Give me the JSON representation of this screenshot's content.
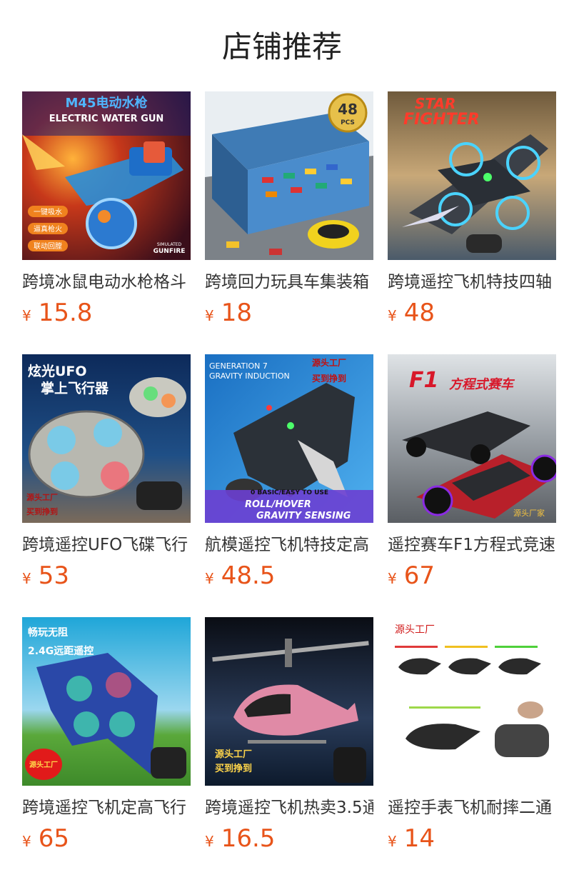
{
  "header": {
    "title": "店铺推荐"
  },
  "currency": "¥",
  "products": [
    {
      "name": "跨境冰鼠电动水枪格斗",
      "price": "15.8",
      "icon": "water-gun-image",
      "img_text": [
        "M45电动水枪",
        "ELECTRIC WATER GUN",
        "一键吸水",
        "逼真枪火",
        "联动回膛",
        "SIMULATED",
        "GUNFIRE"
      ]
    },
    {
      "name": "跨境回力玩具车集装箱",
      "price": "18",
      "icon": "toy-car-container-image",
      "img_text": [
        "48",
        "PCS"
      ]
    },
    {
      "name": "跨境遥控飞机特技四轴",
      "price": "48",
      "icon": "stunt-plane-image",
      "img_text": [
        "STAR",
        "FIGHTER"
      ]
    },
    {
      "name": "跨境遥控UFO飞碟飞行",
      "price": "53",
      "icon": "ufo-drone-image",
      "img_text": [
        "炫光UFO",
        "掌上飞行器",
        "源头工厂",
        "买到挣到"
      ]
    },
    {
      "name": "航模遥控飞机特技定高",
      "price": "48.5",
      "icon": "gravity-plane-image",
      "img_text": [
        "GENERATION 7",
        "GRAVITY INDUCTION",
        "源头工厂",
        "买到挣到",
        "0 BASIC/EASY TO USE",
        "ROLL/HOVER",
        "GRAVITY SENSING"
      ]
    },
    {
      "name": "遥控赛车F1方程式竞速",
      "price": "67",
      "icon": "f1-car-image",
      "img_text": [
        "F1",
        "方程式赛车",
        "源头厂家"
      ]
    },
    {
      "name": "跨境遥控飞机定高飞行",
      "price": "65",
      "icon": "manta-drone-image",
      "img_text": [
        "畅玩无阻",
        "2.4G远距遥控",
        "源头工厂"
      ]
    },
    {
      "name": "跨境遥控飞机热卖3.5通",
      "price": "16.5",
      "icon": "pink-helicopter-image",
      "img_text": [
        "源头工厂",
        "买到挣到"
      ]
    },
    {
      "name": "遥控手表飞机耐摔二通",
      "price": "14",
      "icon": "watch-helicopter-image",
      "img_text": [
        "源头工厂"
      ]
    }
  ],
  "colors": {
    "price": "#e8541a",
    "title": "#222222",
    "name": "#333333"
  }
}
